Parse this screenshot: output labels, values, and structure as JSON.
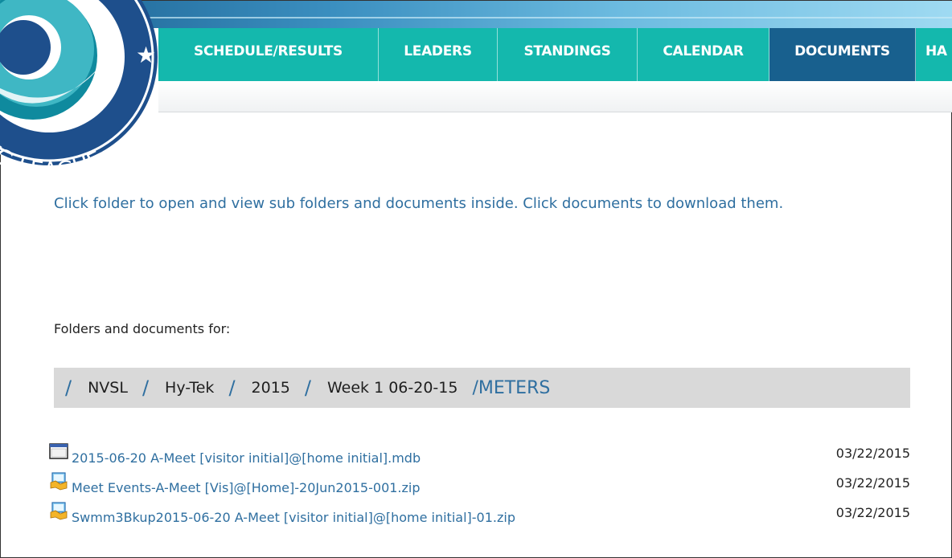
{
  "logo": {
    "text": "VG LEAGUE",
    "star": "★"
  },
  "nav": {
    "items": [
      {
        "label": "SCHEDULE/RESULTS",
        "active": false
      },
      {
        "label": "LEADERS",
        "active": false
      },
      {
        "label": "STANDINGS",
        "active": false
      },
      {
        "label": "CALENDAR",
        "active": false
      },
      {
        "label": "DOCUMENTS",
        "active": true
      },
      {
        "label": "HA",
        "active": false
      }
    ]
  },
  "instructions": "Click folder to open and view sub folders and documents inside. Click documents to download them.",
  "folders_label": "Folders and documents for:",
  "breadcrumb": {
    "separator": "/",
    "items": [
      "NVSL",
      "Hy-Tek",
      "2015",
      "Week 1 06-20-15"
    ],
    "current": "/METERS"
  },
  "documents": [
    {
      "name": "2015-06-20 A-Meet [visitor initial]@[home initial].mdb",
      "date": "03/22/2015",
      "icon": "database-window-icon"
    },
    {
      "name": "Meet Events-A-Meet [Vis]@[Home]-20Jun2015-001.zip",
      "date": "03/22/2015",
      "icon": "zip-archive-icon"
    },
    {
      "name": "Swmm3Bkup2015-06-20 A-Meet [visitor initial]@[home initial]-01.zip",
      "date": "03/22/2015",
      "icon": "zip-archive-icon"
    }
  ],
  "colors": {
    "nav_bg": "#14b8ad",
    "nav_active": "#18608e",
    "link": "#2f6fa0",
    "breadcrumb_bg": "#d9d9d9"
  }
}
